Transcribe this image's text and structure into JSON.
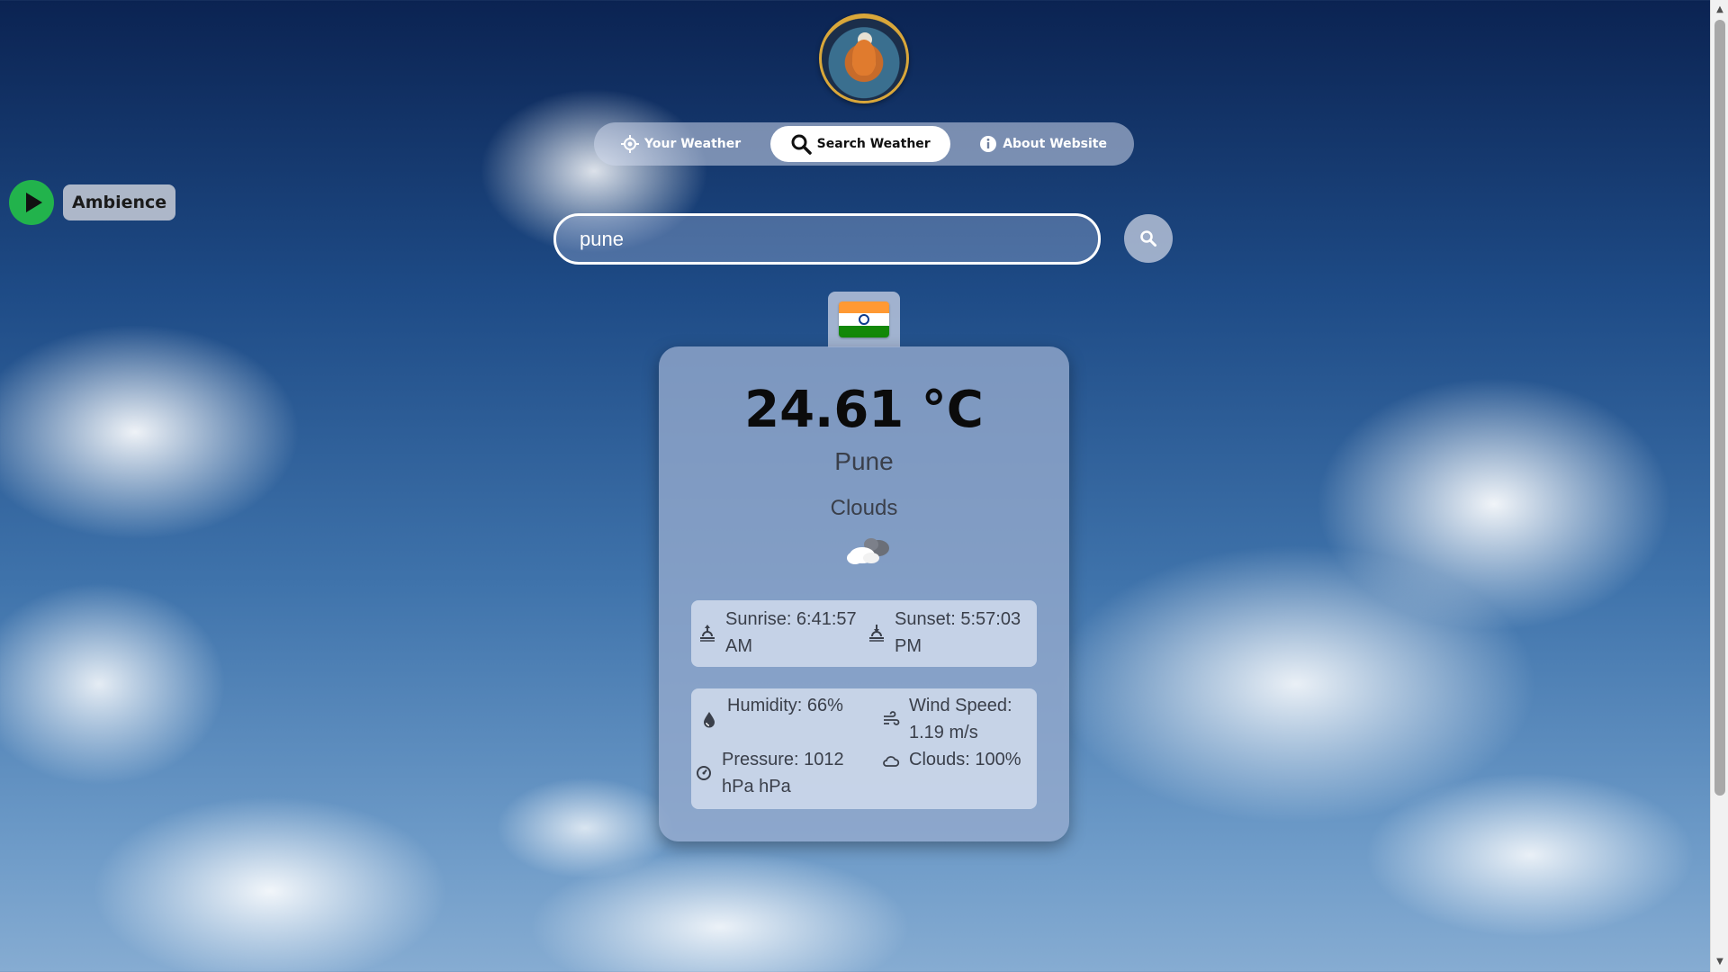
{
  "nav": {
    "items": [
      {
        "label": "Your Weather",
        "icon": "crosshair-icon",
        "active": false
      },
      {
        "label": "Search Weather",
        "icon": "search-icon",
        "active": true
      },
      {
        "label": "About Website",
        "icon": "info-icon",
        "active": false
      }
    ]
  },
  "ambience": {
    "label": "Ambience",
    "icon": "play-icon",
    "color": "#22b34c"
  },
  "search": {
    "value": "pune",
    "button_icon": "search-icon"
  },
  "country": {
    "flag": "india-flag",
    "colors": [
      "#ff9933",
      "#ffffff",
      "#138808"
    ]
  },
  "weather": {
    "temperature": "24.61 °C",
    "city": "Pune",
    "condition": "Clouds",
    "condition_icon": "cloud-icon",
    "sunrise": "Sunrise: 6:41:57 AM",
    "sunset": "Sunset: 5:57:03 PM",
    "humidity": "Humidity: 66%",
    "wind_speed": "Wind Speed: 1.19 m/s",
    "pressure": "Pressure: 1012 hPa hPa",
    "clouds": "Clouds: 100%"
  }
}
